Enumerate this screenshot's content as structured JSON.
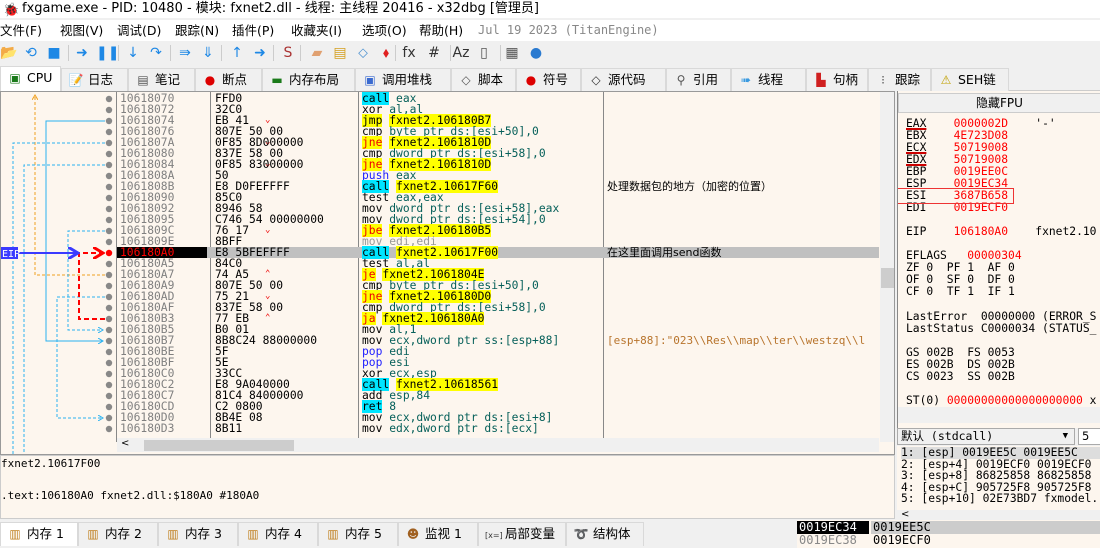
{
  "window": {
    "title": "fxgame.exe - PID: 10480 - 模块: fxnet2.dll - 线程: 主线程 20416 - x32dbg [管理员]"
  },
  "menu": {
    "items": [
      "文件(F)",
      "视图(V)",
      "调试(D)",
      "跟踪(N)",
      "插件(P)",
      "收藏夹(I)",
      "选项(O)",
      "帮助(H)"
    ],
    "build_date": "Jul 19 2023 (TitanEngine)"
  },
  "toolbar": {
    "icons": [
      "open-icon",
      "restart-icon",
      "stop-icon",
      "run-icon",
      "pause-icon",
      "step-into-icon",
      "step-over-icon",
      "trace-into-icon",
      "trace-over-icon",
      "execute-till-return-icon",
      "run-to-user-code-icon",
      "scylla-icon",
      "patch-icon",
      "comments-icon",
      "labels-icon",
      "bookmarks-icon",
      "functions-icon",
      "hash-icon",
      "font-icon",
      "device-icon",
      "calculator-icon",
      "globe-icon"
    ]
  },
  "tabs": [
    {
      "label": "CPU",
      "icon": "cpu-icon",
      "active": true
    },
    {
      "label": "日志",
      "icon": "log-icon"
    },
    {
      "label": "笔记",
      "icon": "notes-icon"
    },
    {
      "label": "断点",
      "icon": "breakpoint-icon"
    },
    {
      "label": "内存布局",
      "icon": "memory-map-icon"
    },
    {
      "label": "调用堆栈",
      "icon": "call-stack-icon"
    },
    {
      "label": "脚本",
      "icon": "script-icon"
    },
    {
      "label": "符号",
      "icon": "symbols-icon"
    },
    {
      "label": "源代码",
      "icon": "source-icon"
    },
    {
      "label": "引用",
      "icon": "references-icon"
    },
    {
      "label": "线程",
      "icon": "threads-icon"
    },
    {
      "label": "句柄",
      "icon": "handles-icon"
    },
    {
      "label": "跟踪",
      "icon": "trace-icon"
    },
    {
      "label": "SEH链",
      "icon": "seh-icon"
    }
  ],
  "disasm": {
    "eip_label": "EIP",
    "rows": [
      {
        "addr": "10618070",
        "bytes": "FFD0",
        "mn": "call",
        "ops": "eax",
        "type": "call"
      },
      {
        "addr": "10618072",
        "bytes": "32C0",
        "mn": "xor",
        "ops": "al,al"
      },
      {
        "addr": "10618074",
        "arrow": "v",
        "bytes": "EB 41",
        "mn": "jmp",
        "ops": "fxnet2.106180B7",
        "type": "jmp"
      },
      {
        "addr": "10618076",
        "bytes": "807E 50 00",
        "mn": "cmp",
        "ops": "byte ptr ds:[esi+50],0"
      },
      {
        "addr": "1061807A",
        "arrow": "v",
        "bytes": "0F85 8D000000",
        "mn": "jne",
        "ops": "fxnet2.1061810D",
        "type": "jcc"
      },
      {
        "addr": "10618080",
        "bytes": "837E 58 00",
        "mn": "cmp",
        "ops": "dword ptr ds:[esi+58],0"
      },
      {
        "addr": "10618084",
        "arrow": "v",
        "bytes": "0F85 83000000",
        "mn": "jne",
        "ops": "fxnet2.1061810D",
        "type": "jcc"
      },
      {
        "addr": "1061808A",
        "bytes": "50",
        "mn": "push",
        "ops": "eax",
        "type": "push"
      },
      {
        "addr": "1061808B",
        "bytes": "E8 D0FEFFFF",
        "mn": "call",
        "ops": "fxnet2.10617F60",
        "type": "call",
        "comment": "处理数据包的地方（加密的位置）"
      },
      {
        "addr": "10618090",
        "bytes": "85C0",
        "mn": "test",
        "ops": "eax,eax"
      },
      {
        "addr": "10618092",
        "bytes": "8946 58",
        "mn": "mov",
        "ops": "dword ptr ds:[esi+58],eax"
      },
      {
        "addr": "10618095",
        "bytes": "C746 54 00000000",
        "mn": "mov",
        "ops": "dword ptr ds:[esi+54],0"
      },
      {
        "addr": "1061809C",
        "arrow": "v",
        "bytes": "76 17",
        "mn": "jbe",
        "ops": "fxnet2.106180B5",
        "type": "jcc"
      },
      {
        "addr": "1061809E",
        "bytes": "8BFF",
        "mn": "mov",
        "ops": "edi,edi",
        "type": "nop"
      },
      {
        "addr": "106180A0",
        "bytes": "E8 5BFEFFFF",
        "mn": "call",
        "ops": "fxnet2.10617F00",
        "type": "call",
        "comment": "在这里面调用send函数",
        "selected": true
      },
      {
        "addr": "106180A5",
        "bytes": "84C0",
        "mn": "test",
        "ops": "al,al"
      },
      {
        "addr": "106180A7",
        "arrow": "^",
        "bytes": "74 A5",
        "mn": "je",
        "ops": "fxnet2.1061804E",
        "type": "jcc"
      },
      {
        "addr": "106180A9",
        "bytes": "807E 50 00",
        "mn": "cmp",
        "ops": "byte ptr ds:[esi+50],0"
      },
      {
        "addr": "106180AD",
        "arrow": "v",
        "bytes": "75 21",
        "mn": "jne",
        "ops": "fxnet2.106180D0",
        "type": "jcc"
      },
      {
        "addr": "106180AF",
        "bytes": "837E 58 00",
        "mn": "cmp",
        "ops": "dword ptr ds:[esi+58],0"
      },
      {
        "addr": "106180B3",
        "arrow": "^",
        "bytes": "77 EB",
        "mn": "ja",
        "ops": "fxnet2.106180A0",
        "type": "jcc"
      },
      {
        "addr": "106180B5",
        "bytes": "B0 01",
        "mn": "mov",
        "ops": "al,1"
      },
      {
        "addr": "106180B7",
        "bytes": "8B8C24 88000000",
        "mn": "mov",
        "ops": "ecx,dword ptr ss:[esp+88]",
        "auto_comment": "[esp+88]:\"023\\\\Res\\\\map\\\\ter\\\\westzq\\\\l"
      },
      {
        "addr": "106180BE",
        "bytes": "5F",
        "mn": "pop",
        "ops": "edi",
        "type": "pop"
      },
      {
        "addr": "106180BF",
        "bytes": "5E",
        "mn": "pop",
        "ops": "esi",
        "type": "pop"
      },
      {
        "addr": "106180C0",
        "bytes": "33CC",
        "mn": "xor",
        "ops": "ecx,esp"
      },
      {
        "addr": "106180C2",
        "bytes": "E8 9A040000",
        "mn": "call",
        "ops": "fxnet2.10618561",
        "type": "call"
      },
      {
        "addr": "106180C7",
        "bytes": "81C4 84000000",
        "mn": "add",
        "ops": "esp,84"
      },
      {
        "addr": "106180CD",
        "bytes": "C2 0800",
        "mn": "ret",
        "ops": "8",
        "type": "ret"
      },
      {
        "addr": "106180D0",
        "bytes": "8B4E 08",
        "mn": "mov",
        "ops": "ecx,dword ptr ds:[esi+8]"
      },
      {
        "addr": "106180D3",
        "bytes": "8B11",
        "mn": "mov",
        "ops": "edx,dword ptr ds:[ecx]"
      }
    ]
  },
  "registers": {
    "fpu_button": "隐藏FPU",
    "gpr": [
      {
        "name": "EAX",
        "value": "0000002D",
        "extra": "'-'"
      },
      {
        "name": "EBX",
        "value": "4E723D08"
      },
      {
        "name": "ECX",
        "value": "50719008"
      },
      {
        "name": "EDX",
        "value": "50719008"
      },
      {
        "name": "EBP",
        "value": "0019EE0C"
      },
      {
        "name": "ESP",
        "value": "0019EC34"
      },
      {
        "name": "ESI",
        "value": "3687B658"
      },
      {
        "name": "EDI",
        "value": "0019ECF0"
      }
    ],
    "eip": {
      "name": "EIP",
      "value": "106180A0",
      "extra": "fxnet2.10"
    },
    "eflags": {
      "name": "EFLAGS",
      "value": "00000304"
    },
    "flags_lines": [
      "ZF 0  PF 1  AF 0",
      "OF 0  SF 0  DF 0",
      "CF 0  TF 1  IF 1"
    ],
    "last_error": "LastError  00000000 (ERROR_S",
    "last_status": "LastStatus C0000034 (STATUS_",
    "seg_lines": [
      "GS 002B  FS 0053",
      "ES 002B  DS 002B",
      "CS 0023  SS 002B"
    ],
    "st0": {
      "name": "ST(0)",
      "value": "00000000000000000000",
      "extra": "x"
    }
  },
  "call_conv": {
    "selected": "默认 (stdcall)",
    "arg_count": "5"
  },
  "args": [
    "1: [esp] 0019EE5C 0019EE5C",
    "2: [esp+4] 0019ECF0 0019ECF0",
    "3: [esp+8] 86825858 86825858",
    "4: [esp+C] 905725F8 905725F8",
    "5: [esp+10] 02E73BD7 fxmodel."
  ],
  "info": {
    "line1": "fxnet2.10617F00",
    "line2": ".text:106180A0 fxnet2.dll:$180A0 #180A0"
  },
  "bottom_tabs": [
    {
      "label": "内存 1",
      "active": true,
      "icon": "memory-icon"
    },
    {
      "label": "内存 2",
      "icon": "memory-icon"
    },
    {
      "label": "内存 3",
      "icon": "memory-icon"
    },
    {
      "label": "内存 4",
      "icon": "memory-icon"
    },
    {
      "label": "内存 5",
      "icon": "memory-icon"
    },
    {
      "label": "监视 1",
      "icon": "watch-icon"
    },
    {
      "label": "局部变量",
      "icon": "locals-icon"
    },
    {
      "label": "结构体",
      "icon": "struct-icon"
    }
  ],
  "stack": [
    {
      "addr": "0019EC34",
      "value": "0019EE5C",
      "current": true
    },
    {
      "addr": "0019EC38",
      "value": "0019ECF0"
    }
  ]
}
